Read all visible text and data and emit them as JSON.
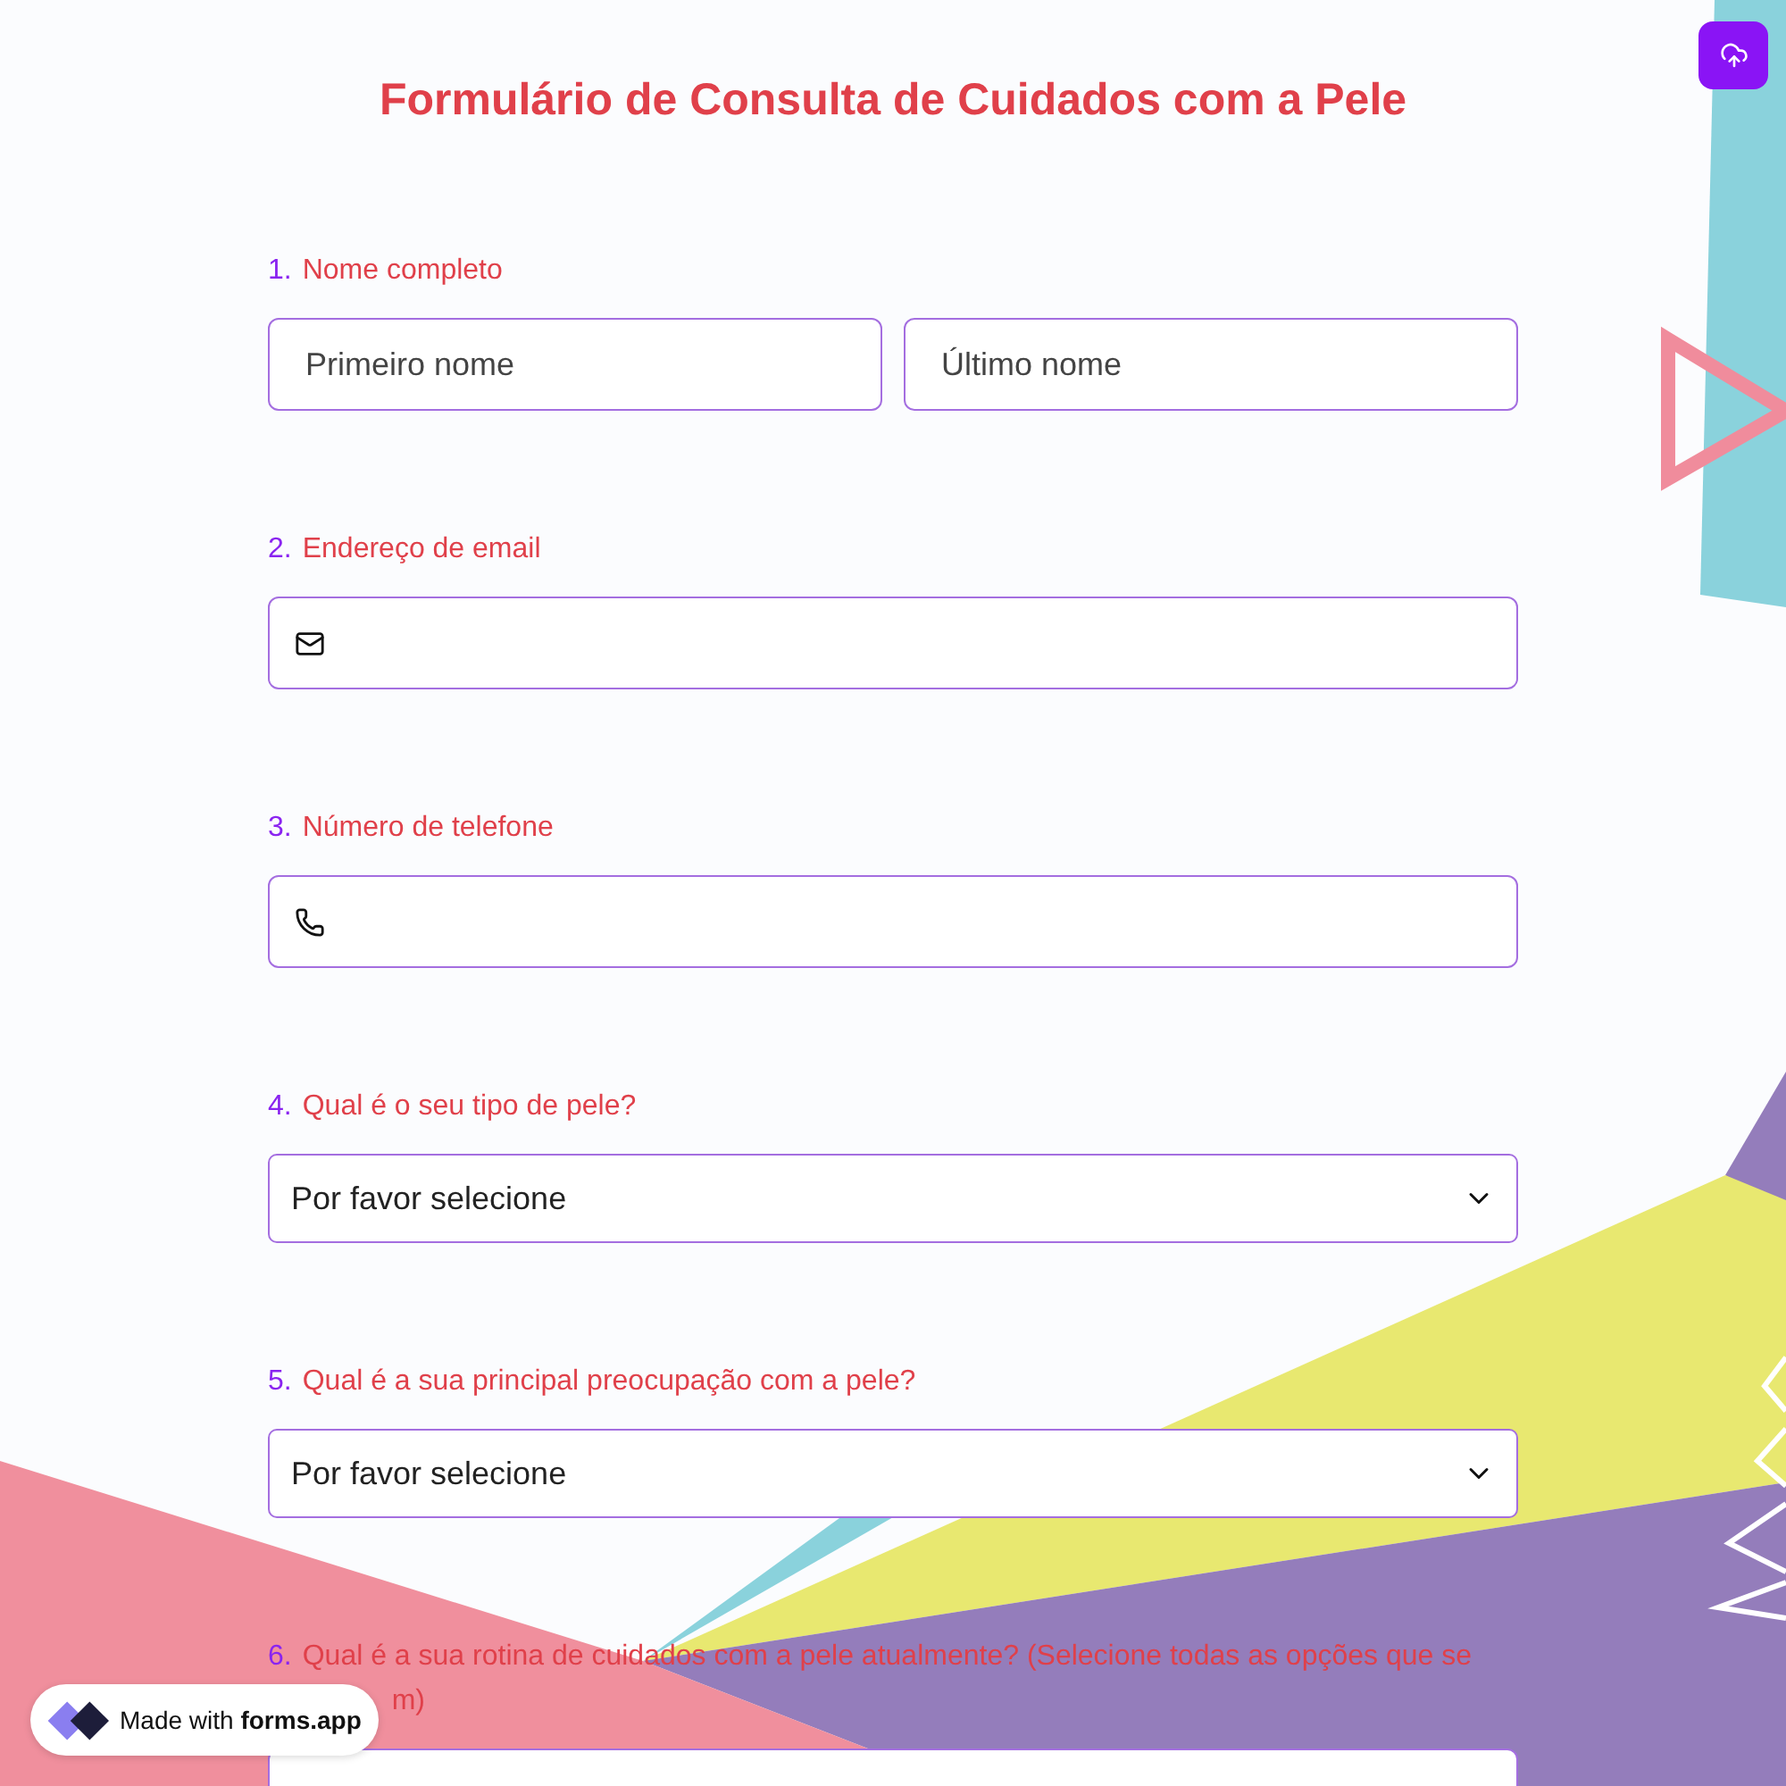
{
  "title": "Formulário de Consulta de Cuidados com a Pele",
  "questions": [
    {
      "number": "1.",
      "label": "Nome completo",
      "kind": "name",
      "placeholders": [
        "Primeiro nome",
        "Último nome"
      ]
    },
    {
      "number": "2.",
      "label": "Endereço de email",
      "kind": "email"
    },
    {
      "number": "3.",
      "label": "Número de telefone",
      "kind": "phone"
    },
    {
      "number": "4.",
      "label": "Qual é o seu tipo de pele?",
      "kind": "select",
      "value": "Por favor selecione"
    },
    {
      "number": "5.",
      "label": "Qual é a sua principal preocupação com a pele?",
      "kind": "select",
      "value": "Por favor selecione"
    },
    {
      "number": "6.",
      "label": "Qual é a sua rotina de cuidados com a pele atualmente? (Selecione todas as opções que se",
      "label_tail": "m)",
      "kind": "options"
    }
  ],
  "badge": {
    "prefix": "Made with",
    "brand": "forms.app"
  }
}
